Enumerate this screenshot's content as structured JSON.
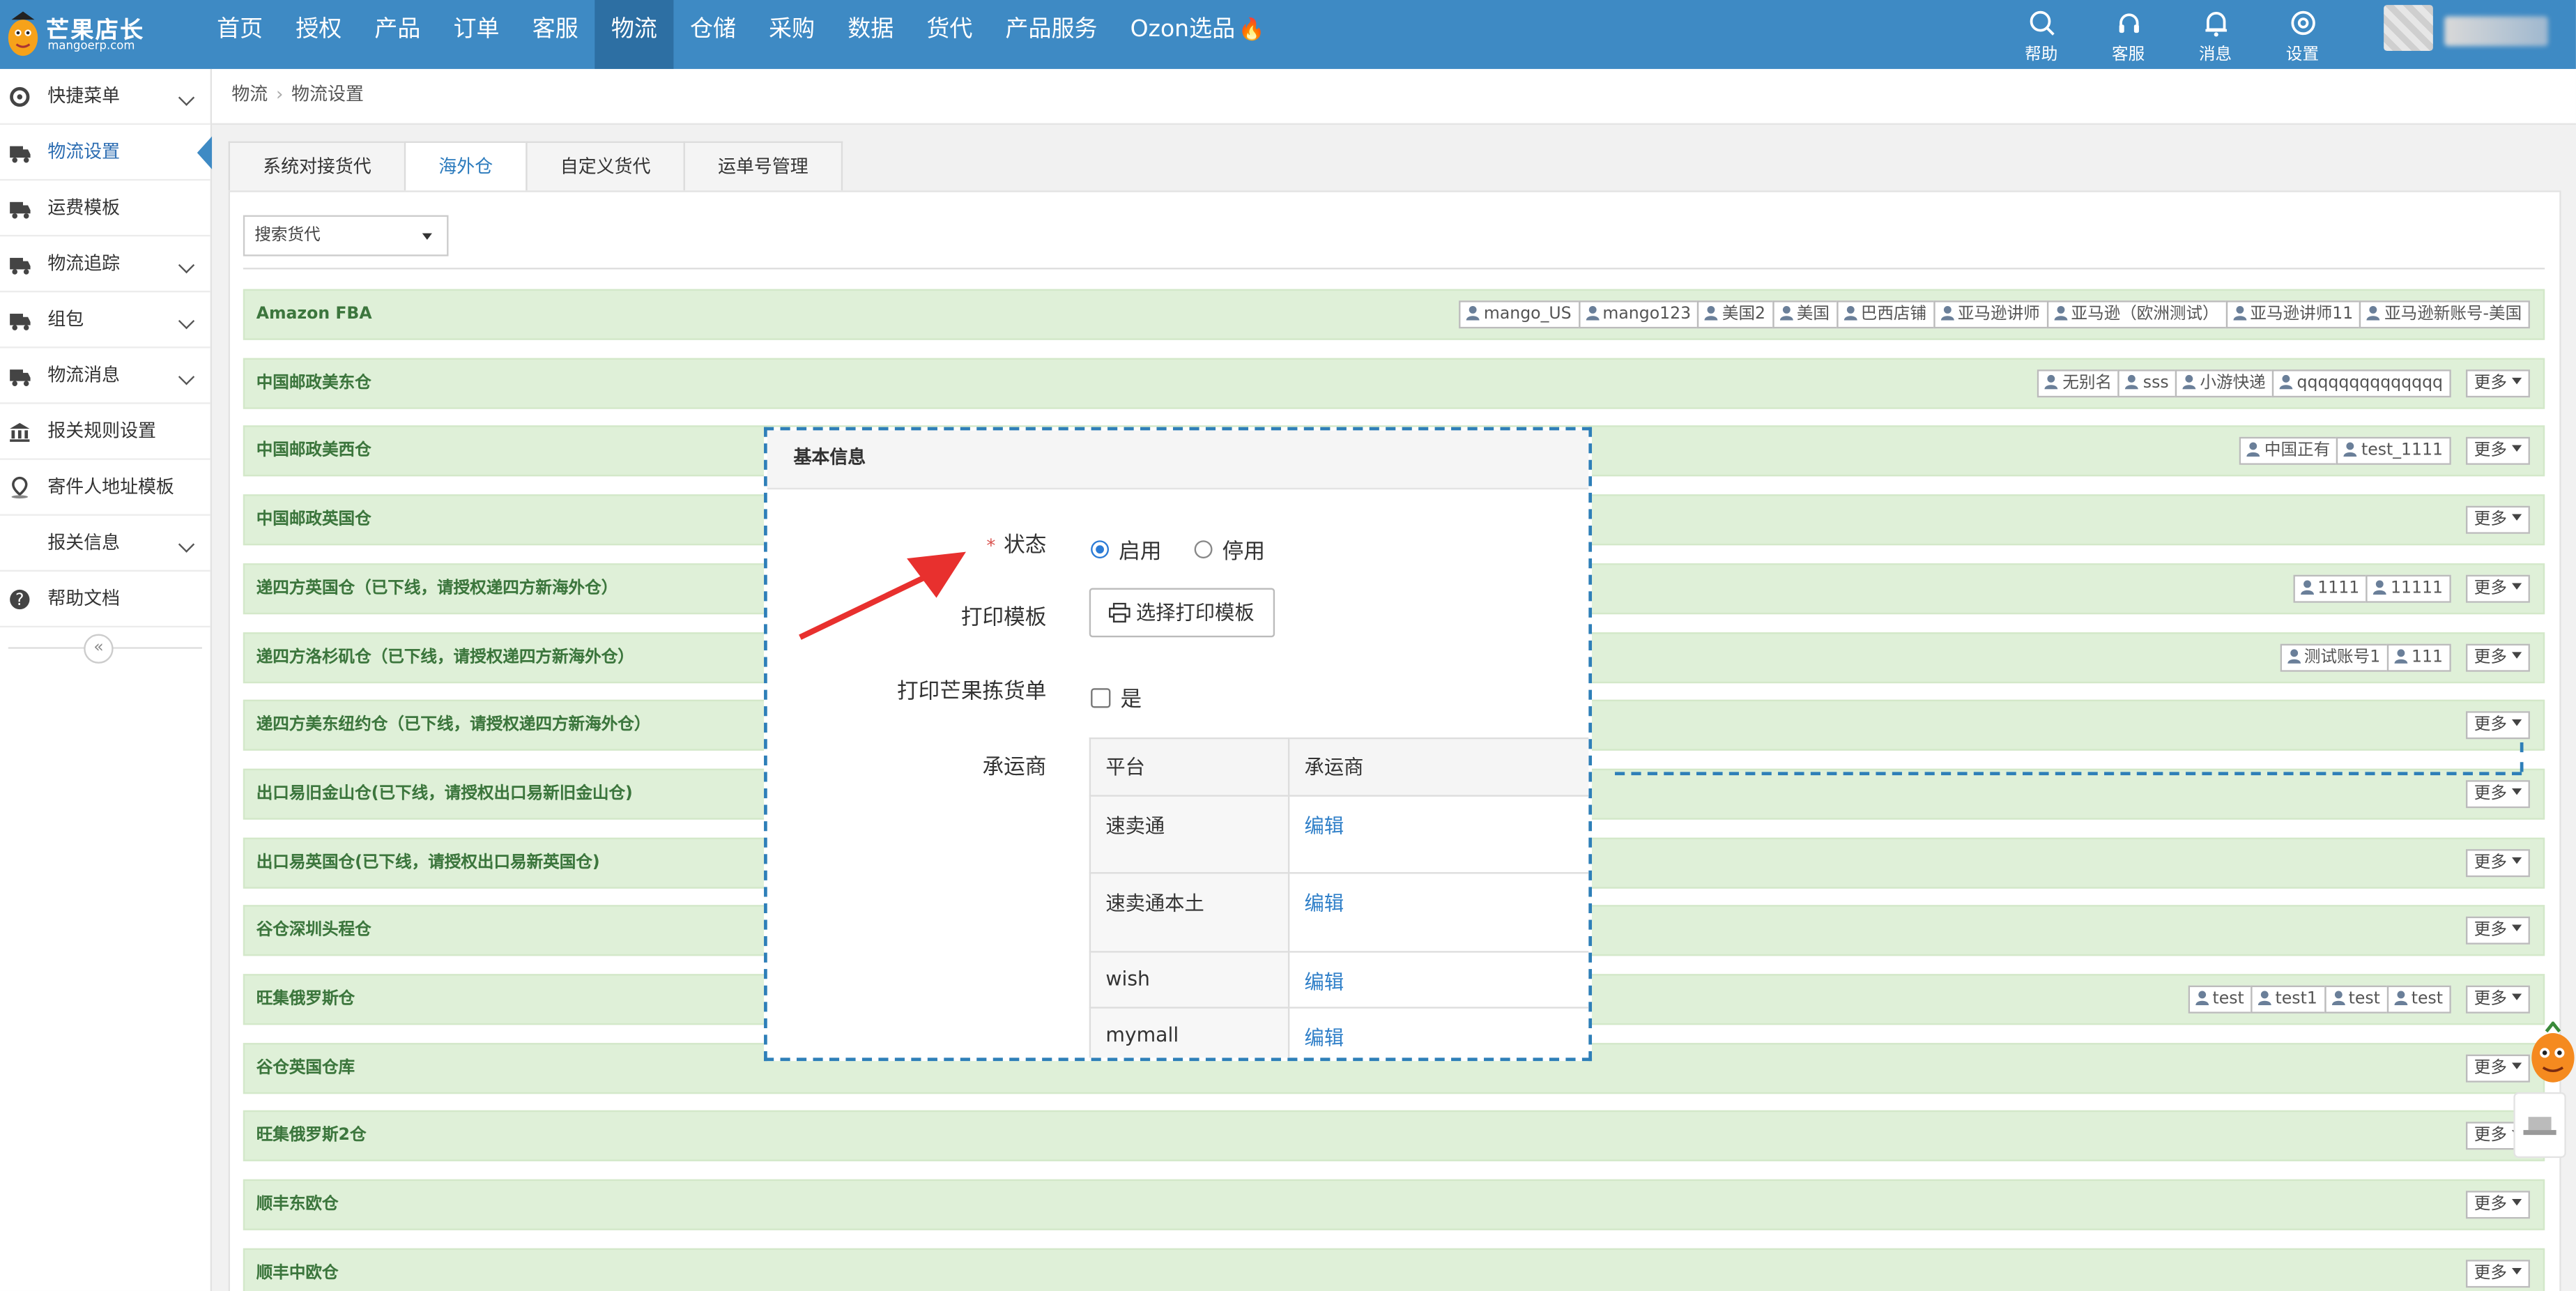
{
  "app": {
    "logo_title": "芒果店长",
    "logo_subtitle": "mangoerp.com"
  },
  "nav": [
    "首页",
    "授权",
    "产品",
    "订单",
    "客服",
    "物流",
    "仓储",
    "采购",
    "数据",
    "货代",
    "产品服务",
    "Ozon选品"
  ],
  "nav_active": "物流",
  "toolbar": {
    "help": "帮助",
    "service": "客服",
    "messages": "消息",
    "settings": "设置"
  },
  "sidebar": [
    {
      "label": "快捷菜单",
      "icon": "gear-icon",
      "has_chevron": true
    },
    {
      "label": "物流设置",
      "icon": "truck-icon",
      "has_chevron": false,
      "active": true
    },
    {
      "label": "运费模板",
      "icon": "truck-icon",
      "has_chevron": false
    },
    {
      "label": "物流追踪",
      "icon": "truck-icon",
      "has_chevron": true
    },
    {
      "label": "组包",
      "icon": "truck-icon",
      "has_chevron": true
    },
    {
      "label": "物流消息",
      "icon": "truck-icon",
      "has_chevron": true
    },
    {
      "label": "报关规则设置",
      "icon": "bank-icon",
      "has_chevron": false
    },
    {
      "label": "寄件人地址模板",
      "icon": "location-icon",
      "has_chevron": false
    },
    {
      "label": "报关信息",
      "icon": "",
      "has_chevron": true
    },
    {
      "label": "帮助文档",
      "icon": "question-icon",
      "has_chevron": false
    }
  ],
  "sidebar_collapse": "«",
  "breadcrumb": [
    "物流",
    "物流设置"
  ],
  "breadcrumb_separator": "›",
  "tabs": [
    "系统对接货代",
    "海外仓",
    "自定义货代",
    "运单号管理"
  ],
  "tab_active": "海外仓",
  "search": {
    "value": "搜索货代"
  },
  "more_label": "更多",
  "warehouses": [
    {
      "name": "Amazon FBA",
      "accounts": [
        "mango_US",
        "mango123",
        "美国2",
        "美国",
        "巴西店铺",
        "亚马逊讲师",
        "亚马逊（欧洲测试）",
        "亚马逊讲师11",
        "亚马逊新账号-美国"
      ],
      "more": false
    },
    {
      "name": "中国邮政美东仓",
      "accounts": [
        "无别名",
        "sss",
        "小游快递",
        "qqqqqqqqqqqqqq"
      ],
      "more": true
    },
    {
      "name": "中国邮政美西仓",
      "accounts": [
        "中国正有",
        "test_1111"
      ],
      "more": true
    },
    {
      "name": "中国邮政英国仓",
      "accounts": [],
      "more": true
    },
    {
      "name": "递四方英国仓（已下线，请授权递四方新海外仓）",
      "accounts": [
        "1111",
        "11111"
      ],
      "more": true
    },
    {
      "name": "递四方洛杉矶仓（已下线，请授权递四方新海外仓）",
      "accounts": [
        "测试账号1",
        "111"
      ],
      "more": true
    },
    {
      "name": "递四方美东纽约仓（已下线，请授权递四方新海外仓）",
      "accounts": [],
      "more": true
    },
    {
      "name": "出口易旧金山仓(已下线，请授权出口易新旧金山仓)",
      "accounts": [],
      "more": true
    },
    {
      "name": "出口易英国仓(已下线，请授权出口易新英国仓)",
      "accounts": [],
      "more": true
    },
    {
      "name": "谷仓深圳头程仓",
      "accounts": [],
      "more": true
    },
    {
      "name": "旺集俄罗斯仓",
      "accounts": [
        "test",
        "test1",
        "test",
        "test"
      ],
      "more": true
    },
    {
      "name": "谷仓英国仓库",
      "accounts": [],
      "more": true
    },
    {
      "name": "旺集俄罗斯2仓",
      "accounts": [],
      "more": true
    },
    {
      "name": "顺丰东欧仓",
      "accounts": [],
      "more": true
    },
    {
      "name": "顺丰中欧仓",
      "accounts": [],
      "more": true
    }
  ],
  "modal": {
    "title": "基本信息",
    "status_label": "状态",
    "required_mark": "*",
    "status_options": [
      "启用",
      "停用"
    ],
    "status_selected": "启用",
    "print_template_label": "打印模板",
    "print_template_button": "选择打印模板",
    "pick_list_label": "打印芒果拣货单",
    "pick_list_option": "是",
    "pick_list_checked": false,
    "carrier_label": "承运商",
    "carrier_headers": [
      "平台",
      "承运商"
    ],
    "carriers": [
      {
        "platform": "速卖通",
        "action": "编辑"
      },
      {
        "platform": "速卖通本土",
        "action": "编辑"
      },
      {
        "platform": "wish",
        "action": "编辑"
      },
      {
        "platform": "mymall",
        "action": "编辑"
      }
    ]
  },
  "colors": {
    "topbar": "#3e8ac4",
    "nav_active": "#2d6fa3",
    "row_bg": "#dff0d8",
    "row_text": "#3c763d",
    "link": "#2f7fc8",
    "annotation": "#2e7fb8",
    "arrow": "#e8302e"
  }
}
